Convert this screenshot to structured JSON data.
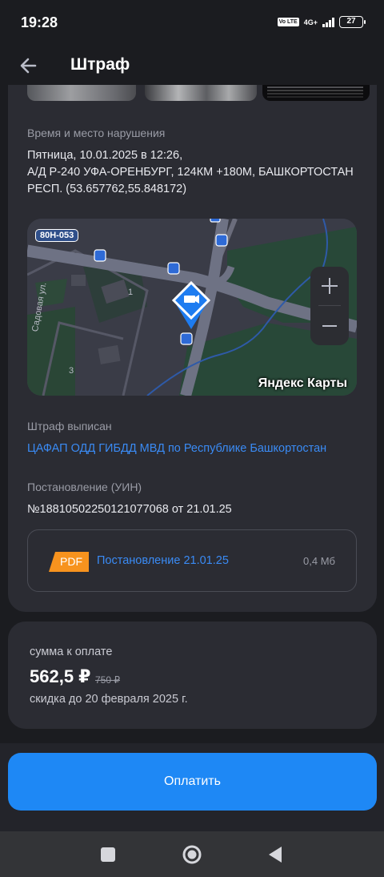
{
  "status_bar": {
    "time": "19:28",
    "network": "4G+",
    "volte": "Vo LTE",
    "battery": "27"
  },
  "header": {
    "title": "Штраф",
    "back_icon": "arrow-left-icon"
  },
  "violation": {
    "time_place_label": "Время и место нарушения",
    "date_line": "Пятница, 10.01.2025 в 12:26,",
    "road_line": "А/Д Р-240 УФА-ОРЕНБУРГ, 124КМ +180М, БАШКОРТОСТАН",
    "region_line": "РЕСП. (53.657762,55.848172)"
  },
  "map": {
    "road_label": "80Н-053",
    "street_label": "Садовая ул.",
    "building_numbers": [
      "1",
      "3"
    ],
    "provider": "Яндекс Карты",
    "zoom_in": "+",
    "zoom_out": "−",
    "marker_icon": "camera-marker-icon"
  },
  "issuer": {
    "label": "Штраф выписан",
    "name": "ЦАФАП ОДД ГИБДД МВД по Республике Башкортостан"
  },
  "resolution": {
    "label": "Постановление (УИН)",
    "number": "№18810502250121077068 от 21.01.25"
  },
  "document": {
    "badge": "PDF",
    "name": "Постановление 21.01.25",
    "size": "0,4 Мб"
  },
  "payment": {
    "label": "сумма к оплате",
    "amount": "562,5 ₽",
    "old_amount": "750 ₽",
    "discount": "скидка до 20 февраля 2025 г.",
    "button": "Оплатить"
  },
  "colors": {
    "accent": "#1e88f5",
    "link": "#3a8bf5",
    "pdf_badge": "#f7931e",
    "card": "#2b2c33",
    "background": "#1b1c20"
  }
}
